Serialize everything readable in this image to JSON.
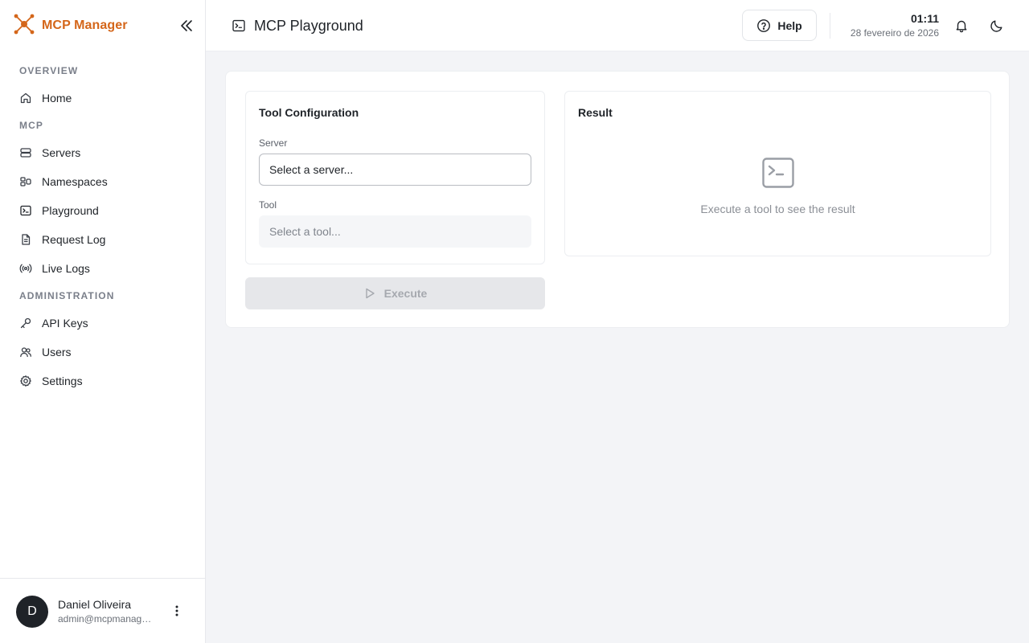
{
  "app": {
    "name": "MCP Manager",
    "accent": "#d4661a"
  },
  "sidebar": {
    "sections": [
      {
        "label": "OVERVIEW",
        "items": [
          {
            "label": "Home",
            "icon": "home-icon"
          }
        ]
      },
      {
        "label": "MCP",
        "items": [
          {
            "label": "Servers",
            "icon": "server-icon"
          },
          {
            "label": "Namespaces",
            "icon": "namespace-icon"
          },
          {
            "label": "Playground",
            "icon": "terminal-icon",
            "active": true
          },
          {
            "label": "Request Log",
            "icon": "file-text-icon"
          },
          {
            "label": "Live Logs",
            "icon": "radio-icon"
          }
        ]
      },
      {
        "label": "ADMINISTRATION",
        "items": [
          {
            "label": "API Keys",
            "icon": "key-icon"
          },
          {
            "label": "Users",
            "icon": "users-icon"
          },
          {
            "label": "Settings",
            "icon": "gear-icon"
          }
        ]
      }
    ],
    "user": {
      "initial": "D",
      "name": "Daniel Oliveira",
      "email": "admin@mcpmanager.local"
    }
  },
  "header": {
    "title": "MCP Playground",
    "help_label": "Help",
    "time": "01:11",
    "date": "28 fevereiro de 2026"
  },
  "config": {
    "title": "Tool Configuration",
    "server_label": "Server",
    "server_placeholder": "Select a server...",
    "tool_label": "Tool",
    "tool_placeholder": "Select a tool...",
    "execute_label": "Execute"
  },
  "result": {
    "title": "Result",
    "empty_text": "Execute a tool to see the result"
  }
}
